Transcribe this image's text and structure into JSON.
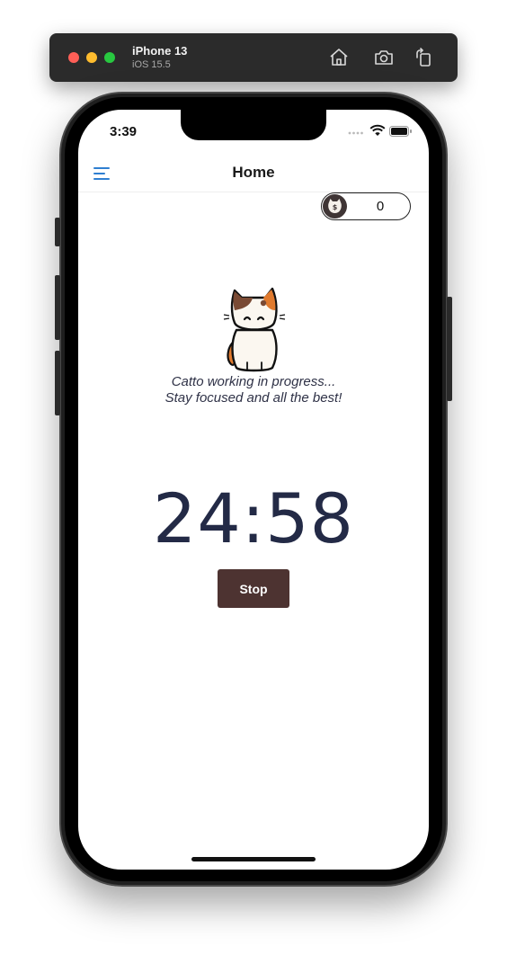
{
  "simulator": {
    "device_name": "iPhone 13",
    "os_version": "iOS 15.5",
    "toolbar_icons": [
      "home-icon",
      "screenshot-icon",
      "rotate-icon"
    ]
  },
  "status_bar": {
    "time": "3:39",
    "icons": [
      "cellular-dots-icon",
      "wifi-icon",
      "battery-icon"
    ]
  },
  "header": {
    "title": "Home",
    "menu_icon": "hamburger-menu-icon"
  },
  "coins": {
    "count": "0",
    "icon": "cat-coin-icon"
  },
  "main": {
    "message_line1": "Catto working in progress...",
    "message_line2": "Stay focused and all the best!",
    "timer": "24:58",
    "stop_label": "Stop"
  },
  "colors": {
    "accent_blue": "#2f7fd1",
    "timer_text": "#232a46",
    "stop_button": "#4d3331",
    "cat_brown": "#7a4a34",
    "cat_orange": "#e07a2e"
  }
}
